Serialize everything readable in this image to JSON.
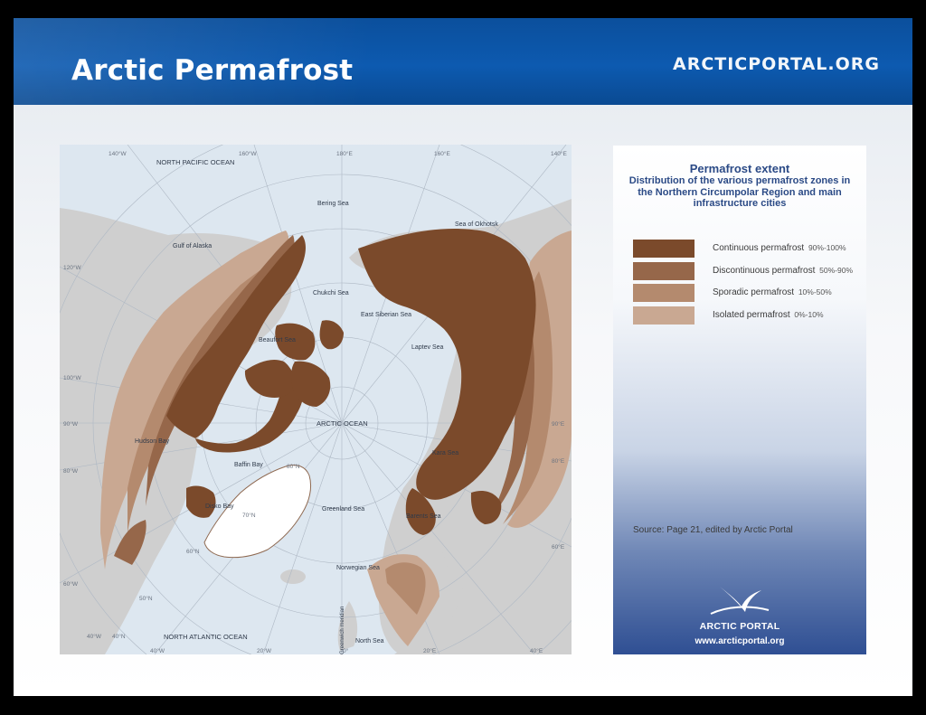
{
  "header": {
    "title": "Arctic Permafrost",
    "brand": "ARCTICPORTAL.ORG"
  },
  "map": {
    "labels": {
      "north_pacific": "NORTH PACIFIC OCEAN",
      "north_atlantic": "NORTH ATLANTIC OCEAN",
      "arctic_ocean": "ARCTIC OCEAN",
      "bering_sea": "Bering Sea",
      "sea_of_okhotsk": "Sea of Okhotsk",
      "gulf_of_alaska": "Gulf of Alaska",
      "chukchi_sea": "Chukchi Sea",
      "east_siberian_sea": "East Siberian Sea",
      "beaufort_sea": "Beaufort Sea",
      "laptev_sea": "Laptev Sea",
      "hudson_bay": "Hudson Bay",
      "baffin_bay": "Baffin Bay",
      "kara_sea": "Kara Sea",
      "disko_bay": "Disko Bay",
      "greenland_sea": "Greenland Sea",
      "barents_sea": "Barents Sea",
      "norwegian_sea": "Norwegian Sea",
      "north_sea": "North Sea",
      "greenwich_meridian": "Greenwich meridian"
    },
    "graticule": {
      "lon_140w": "140°W",
      "lon_160w": "160°W",
      "lon_180e": "180°E",
      "lon_160e": "160°E",
      "lon_140e": "140°E",
      "lon_120w": "120°W",
      "lon_100w": "100°W",
      "lon_90w": "90°W",
      "lon_80w": "80°W",
      "lon_60w": "60°W",
      "lon_40w": "40°W",
      "lon_20w": "20°W",
      "lon_0": "0°",
      "lon_20e": "20°E",
      "lon_40e": "40°E",
      "lon_90e": "90°E",
      "lon_80e": "80°E",
      "lon_60e": "60°E",
      "lat_80n": "80°N",
      "lat_70n": "70°N",
      "lat_60n": "60°N",
      "lat_50n": "50°N",
      "lat_40n": "40°N"
    },
    "colors": {
      "ocean": "#dde7f0",
      "land": "#cfcfcf",
      "greenland_ice": "#ffffff",
      "continuous": "#7b4a2b",
      "discontinuous": "#97684a",
      "sporadic": "#b58b6f",
      "isolated": "#c9a892"
    }
  },
  "legend": {
    "title": "Permafrost extent",
    "subtitle": "Distribution of the various permafrost zones in the Northern Circumpolar Region and main infrastructure cities",
    "items": [
      {
        "label": "Continuous permafrost",
        "range": "90%-100%",
        "color": "#7b4a2b"
      },
      {
        "label": "Discontinuous permafrost",
        "range": "50%-90%",
        "color": "#96674a"
      },
      {
        "label": "Sporadic permafrost",
        "range": "10%-50%",
        "color": "#b48a6e"
      },
      {
        "label": "Isolated permafrost",
        "range": "0%-10%",
        "color": "#c9a892"
      }
    ],
    "source": "Source: Page 21, edited by Arctic Portal",
    "logo_name": "ARCTIC PORTAL",
    "logo_url": "www.arcticportal.org",
    "logo_icon": "bird-icon"
  }
}
